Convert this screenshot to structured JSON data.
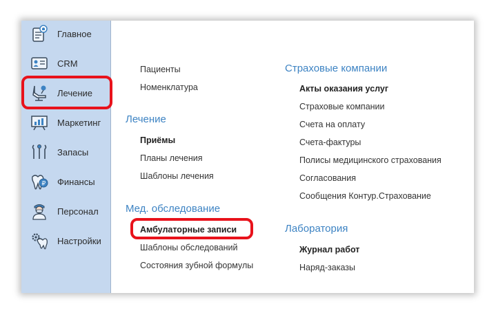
{
  "sidebar": {
    "items": [
      {
        "label": "Главное",
        "icon": "dashboard-icon"
      },
      {
        "label": "CRM",
        "icon": "contact-card-icon"
      },
      {
        "label": "Лечение",
        "icon": "dental-chair-icon"
      },
      {
        "label": "Маркетинг",
        "icon": "presentation-board-icon"
      },
      {
        "label": "Запасы",
        "icon": "dental-tools-icon"
      },
      {
        "label": "Финансы",
        "icon": "tooth-coin-icon"
      },
      {
        "label": "Персонал",
        "icon": "doctor-icon"
      },
      {
        "label": "Настройки",
        "icon": "tooth-gear-icon"
      }
    ]
  },
  "col1": {
    "top_links": [
      "Пациенты",
      "Номенклатура"
    ],
    "treatment": {
      "heading": "Лечение",
      "links": [
        "Приёмы",
        "Планы лечения",
        "Шаблоны лечения"
      ]
    },
    "exam": {
      "heading": "Мед. обследование",
      "links": [
        "Амбулаторные записи",
        "Шаблоны обследований",
        "Состояния зубной формулы"
      ]
    }
  },
  "col2": {
    "insurance": {
      "heading": "Страховые компании",
      "links": [
        "Акты оказания услуг",
        "Страховые компании",
        "Счета на оплату",
        "Счета-фактуры",
        "Полисы медицинского страхования",
        "Согласования",
        "Сообщения Контур.Страхование"
      ]
    },
    "lab": {
      "heading": "Лаборатория",
      "links": [
        "Журнал работ",
        "Наряд-заказы"
      ]
    }
  },
  "colors": {
    "sidebar_bg": "#c5d8ef",
    "heading": "#3d83c3",
    "highlight": "#e8121b"
  }
}
